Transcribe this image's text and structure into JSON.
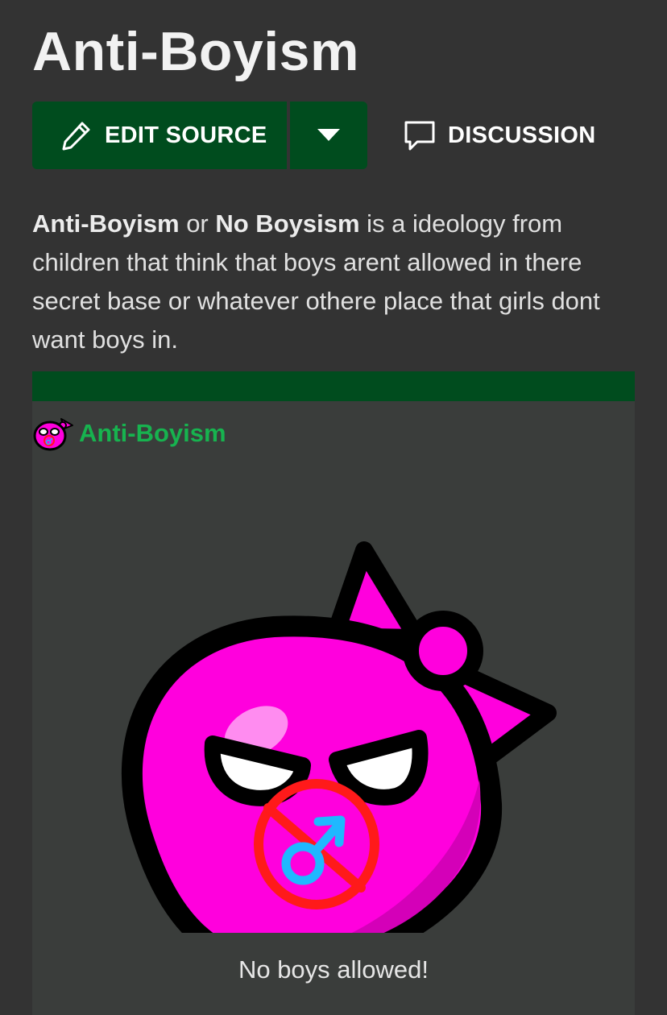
{
  "page": {
    "title": "Anti-Boyism"
  },
  "toolbar": {
    "edit_label": "EDIT SOURCE",
    "discussion_label": "DISCUSSION"
  },
  "intro": {
    "term1": "Anti-Boyism",
    "connector": " or ",
    "term2": "No Boysism",
    "rest": " is a ideology from children that think that boys arent allowed in there secret base or whatever othere place that girls dont want boys in."
  },
  "infobox": {
    "name": "Anti-Boyism",
    "caption": "No boys allowed!"
  },
  "colors": {
    "background": "#333333",
    "accent_green": "#004c1e",
    "link_green": "#17b34f",
    "ball_magenta": "#ff00dd",
    "prohibition_red": "#ff1a1a",
    "male_symbol_blue": "#1fb8ff"
  },
  "icons": {
    "edit": "pencil-icon",
    "dropdown": "chevron-down-icon",
    "discussion": "speech-bubble-icon",
    "infobox_mini": "anti-boyism-ball-icon"
  }
}
